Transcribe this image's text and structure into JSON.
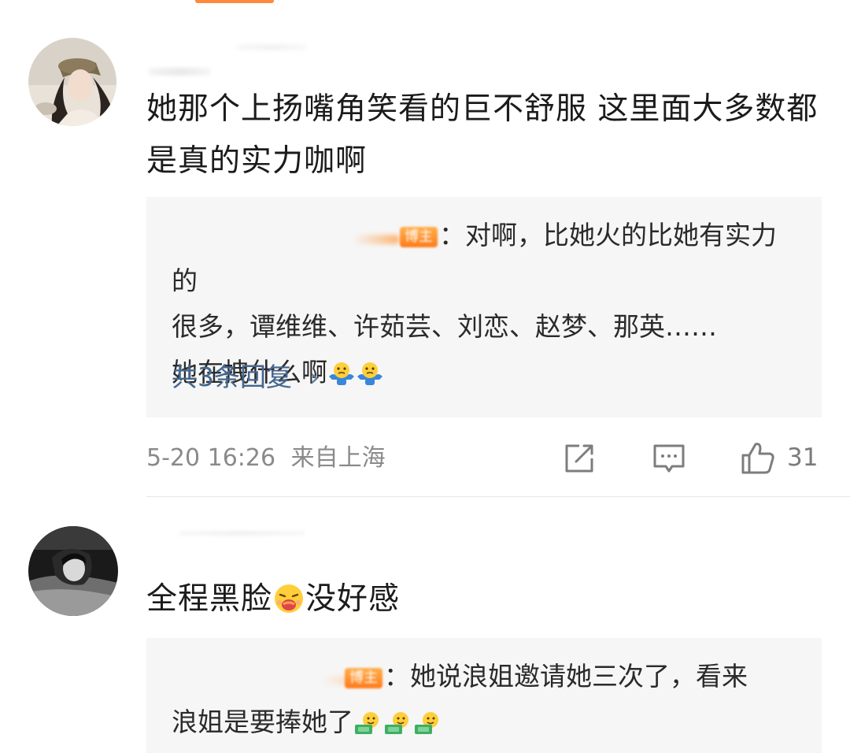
{
  "comments": [
    {
      "text": "她那个上扬嘴角笑看的巨不舒服 这里面大多数都是真的实力咖啊",
      "reply": {
        "text_line1": "：对啊，比她火的比她有实力的",
        "text_line2": "很多，谭维维、许茹芸、刘恋、赵梦、那英……",
        "text_line3": "她在拽什么啊",
        "badge": "博主",
        "more_label": "共3条回复",
        "more_chevron": "›"
      },
      "time": "5-20 16:26",
      "location": "来自上海",
      "likes": "31"
    },
    {
      "text": "全程黑脸",
      "text_after_emoji": "没好感",
      "reply": {
        "text_line1": "：她说浪姐邀请她三次了，看来",
        "text_line2": "浪姐是要捧她了",
        "badge": "博主"
      }
    }
  ],
  "icons": {
    "share": "share-icon",
    "comment": "comment-icon",
    "like": "thumbs-up-icon",
    "shrug_emoji": "shrug-emoji",
    "vomit_emoji": "vomit-emoji",
    "money_emoji": "money-emoji"
  },
  "colors": {
    "link": "#45678f",
    "meta": "#8a8a8a",
    "reply_bg": "#f6f6f6",
    "badge": "#ff8a2a"
  }
}
